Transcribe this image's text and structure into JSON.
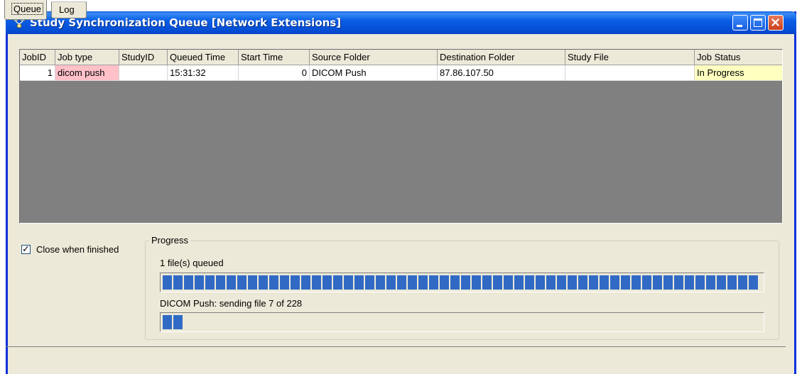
{
  "window": {
    "title": "Study Synchronization Queue [Network Extensions]"
  },
  "colors": {
    "titlebar": "#0a5ee6",
    "grid_background": "#808080",
    "job_type_highlight": "#ffc0c8",
    "status_highlight": "#ffffc0",
    "progress_fill": "#316ac5"
  },
  "grid": {
    "columns": [
      "JobID",
      "Job type",
      "StudyID",
      "Queued Time",
      "Start Time",
      "Source Folder",
      "Destination Folder",
      "Study File",
      "Job Status"
    ],
    "rows": [
      {
        "job_id": "1",
        "job_type": "dicom push",
        "study_id": "",
        "queued_time": "15:31:32",
        "start_time": "0",
        "source_folder": "DICOM Push",
        "destination_folder": "87.86.107.50",
        "study_file": "",
        "job_status": "In Progress"
      }
    ]
  },
  "options": {
    "close_when_finished_label": "Close when finished",
    "close_when_finished_checked": true
  },
  "progress": {
    "group_label": "Progress",
    "queued_label": "1 file(s) queued",
    "queued_fraction": 1.0,
    "sending_label": "DICOM Push: sending file 7 of 228",
    "sending_fraction": 0.0307
  },
  "tabs": {
    "queue_label": "Queue",
    "log_label": "Log"
  }
}
